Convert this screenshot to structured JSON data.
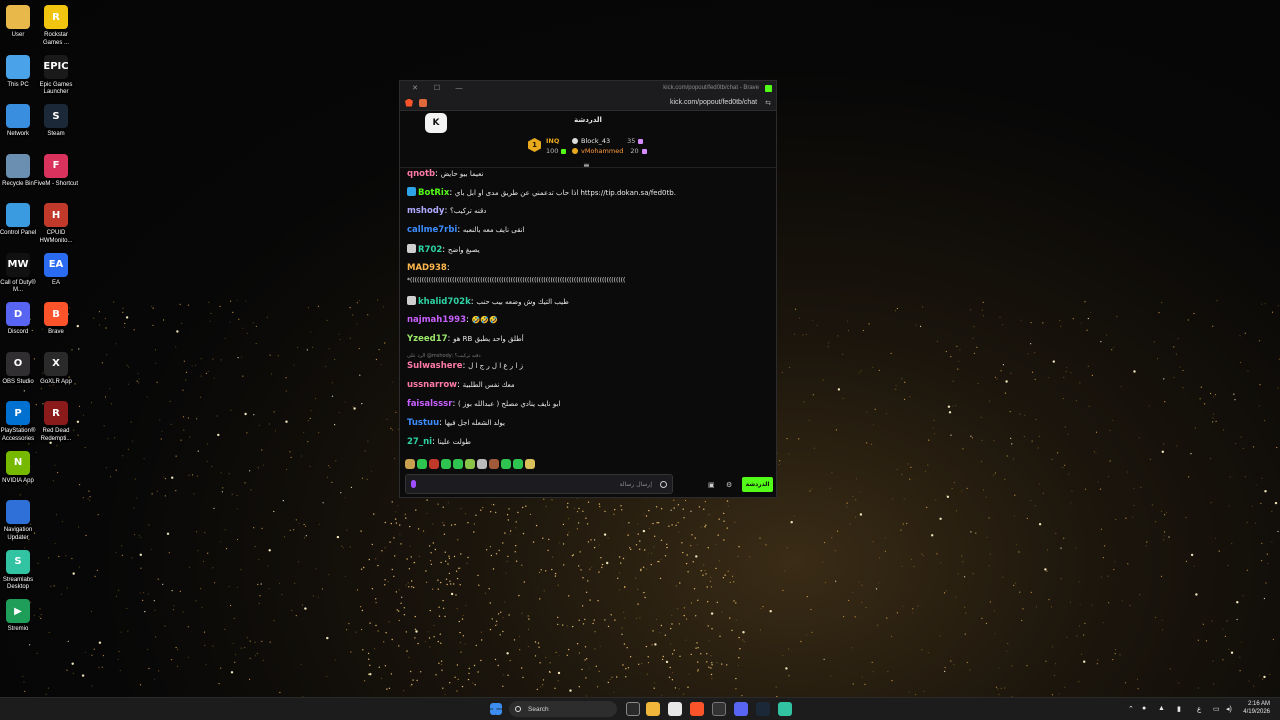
{
  "desktop_icons": [
    {
      "label": "User",
      "color": "#e8b84a",
      "glyph": "",
      "col": 0,
      "row": 0
    },
    {
      "label": "Rockstar Games ...",
      "color": "#f1c40f",
      "glyph": "R",
      "col": 1,
      "row": 0
    },
    {
      "label": "This PC",
      "color": "#4aa3e8",
      "glyph": "",
      "col": 0,
      "row": 1
    },
    {
      "label": "Epic Games Launcher",
      "color": "#1a1a1a",
      "glyph": "EPIC",
      "col": 1,
      "row": 1
    },
    {
      "label": "Network",
      "color": "#3a8ee0",
      "glyph": "",
      "col": 0,
      "row": 2
    },
    {
      "label": "Steam",
      "color": "#1b2838",
      "glyph": "S",
      "col": 1,
      "row": 2
    },
    {
      "label": "Recycle Bin",
      "color": "#6a8fb0",
      "glyph": "",
      "col": 0,
      "row": 3
    },
    {
      "label": "FiveM - Shortcut",
      "color": "#d9325d",
      "glyph": "F",
      "col": 1,
      "row": 3
    },
    {
      "label": "Control Panel",
      "color": "#3b9be0",
      "glyph": "",
      "col": 0,
      "row": 4
    },
    {
      "label": "CPUID HWMonito...",
      "color": "#c0392b",
      "glyph": "H",
      "col": 1,
      "row": 4
    },
    {
      "label": "Call of Duty® M...",
      "color": "#111111",
      "glyph": "MW",
      "col": 0,
      "row": 5
    },
    {
      "label": "EA",
      "color": "#2a6bf2",
      "glyph": "EA",
      "col": 1,
      "row": 5
    },
    {
      "label": "Discord",
      "color": "#5865f2",
      "glyph": "D",
      "col": 0,
      "row": 6
    },
    {
      "label": "Brave",
      "color": "#fb542b",
      "glyph": "B",
      "col": 1,
      "row": 6
    },
    {
      "label": "OBS Studio",
      "color": "#302e31",
      "glyph": "O",
      "col": 0,
      "row": 7
    },
    {
      "label": "GoXLR App",
      "color": "#2a2a2a",
      "glyph": "X",
      "col": 1,
      "row": 7
    },
    {
      "label": "PlayStation® Accessories",
      "color": "#0070d1",
      "glyph": "P",
      "col": 0,
      "row": 8
    },
    {
      "label": "Red Dead Redempti...",
      "color": "#8b1a1a",
      "glyph": "R",
      "col": 1,
      "row": 8
    },
    {
      "label": "NVIDIA App",
      "color": "#76b900",
      "glyph": "N",
      "col": 0,
      "row": 9
    },
    {
      "label": "Navigation Updater",
      "color": "#2f6fd8",
      "glyph": "",
      "col": 0,
      "row": 10
    },
    {
      "label": "Streamlabs Desktop",
      "color": "#31c3a2",
      "glyph": "S",
      "col": 0,
      "row": 11
    },
    {
      "label": "Stremio",
      "color": "#1f9e5a",
      "glyph": "▶",
      "col": 0,
      "row": 12
    }
  ],
  "browser": {
    "title": "kick.com/popout/fed0tb/chat - Brave",
    "url": "kick.com/popout/fed0tb/chat",
    "controls": {
      "close": "✕",
      "max": "☐",
      "min": "—"
    }
  },
  "chat": {
    "header": "الدردشة",
    "logo": "K",
    "leaderboard": {
      "rank": "1",
      "items": [
        {
          "name": "INQ",
          "value": "100",
          "color": "#e9a91c"
        },
        {
          "name": "Block_43",
          "value": "35",
          "color": "#e8e8ea"
        },
        {
          "name": "vMohammed",
          "value": "20",
          "color": "#ff9a3c"
        }
      ]
    },
    "messages": [
      {
        "user": "qnotb",
        "color": "#ff7aa8",
        "text": "نعيما بيو حايض",
        "badge": null
      },
      {
        "user": "BotRix",
        "color": "#53fc18",
        "text": "اذا حاب تدعمني عن طريق مدى او ابل باي https://tip.dokan.sa/fed0tb.",
        "badge": "#2fa3e8"
      },
      {
        "user": "mshody",
        "color": "#b0aaff",
        "text": "دقنه تركيب؟",
        "badge": null
      },
      {
        "user": "callme7rbi",
        "color": "#3c8dff",
        "text": "انقى نايف معه بالنعبه",
        "badge": null
      },
      {
        "user": "R702",
        "color": "#2ed3a3",
        "text": "يصبغ واضح",
        "badge": "#cfcfcf"
      },
      {
        "user": "MAD938",
        "color": "#ffb84d",
        "text": "",
        "badge": null
      },
      {
        "user": "khalid702k",
        "color": "#2ed3a3",
        "text": "طيب التيك وش وضعه بيب حنب",
        "badge": "#cfcfcf"
      },
      {
        "user": "najmah1993",
        "color": "#c860ff",
        "text": "🤣🤣🤣",
        "badge": null
      },
      {
        "user": "Yzeed17",
        "color": "#9be86a",
        "text": "هو RB أطلق واحد يطبق",
        "badge": null
      },
      {
        "user": "Sulwashere",
        "color": "#ff7aa8",
        "text": "ز ا ر ع ا ل ر ج ا ل",
        "badge": null
      },
      {
        "user": "ussnarrow",
        "color": "#ff7aa8",
        "text": "معك نفس الطلبية",
        "badge": null
      },
      {
        "user": "faisalsssr",
        "color": "#c860ff",
        "text": "ابو نايف ينادي مصلح ( عبدالله بوز )",
        "badge": null
      },
      {
        "user": "Tustuu",
        "color": "#3c8dff",
        "text": "يولد الشعله اجل فيها",
        "badge": null
      },
      {
        "user": "27_ni",
        "color": "#2ed3a3",
        "text": "طولت علينا",
        "badge": null
      }
    ],
    "mad938_line": "*((((((((((((((((((((((((((((((((((((((((((((((((((((((((((((((((((((((((((((((((((((((((((((",
    "reply_text": "الرد على @mshody: دقنه تركيب؟",
    "input_placeholder": "إرسال رسالة",
    "send_label": "الدردشة"
  },
  "taskbar": {
    "search_label": "Search",
    "time": "2:16 AM",
    "date": "4/19/2026",
    "lang": "ع"
  }
}
